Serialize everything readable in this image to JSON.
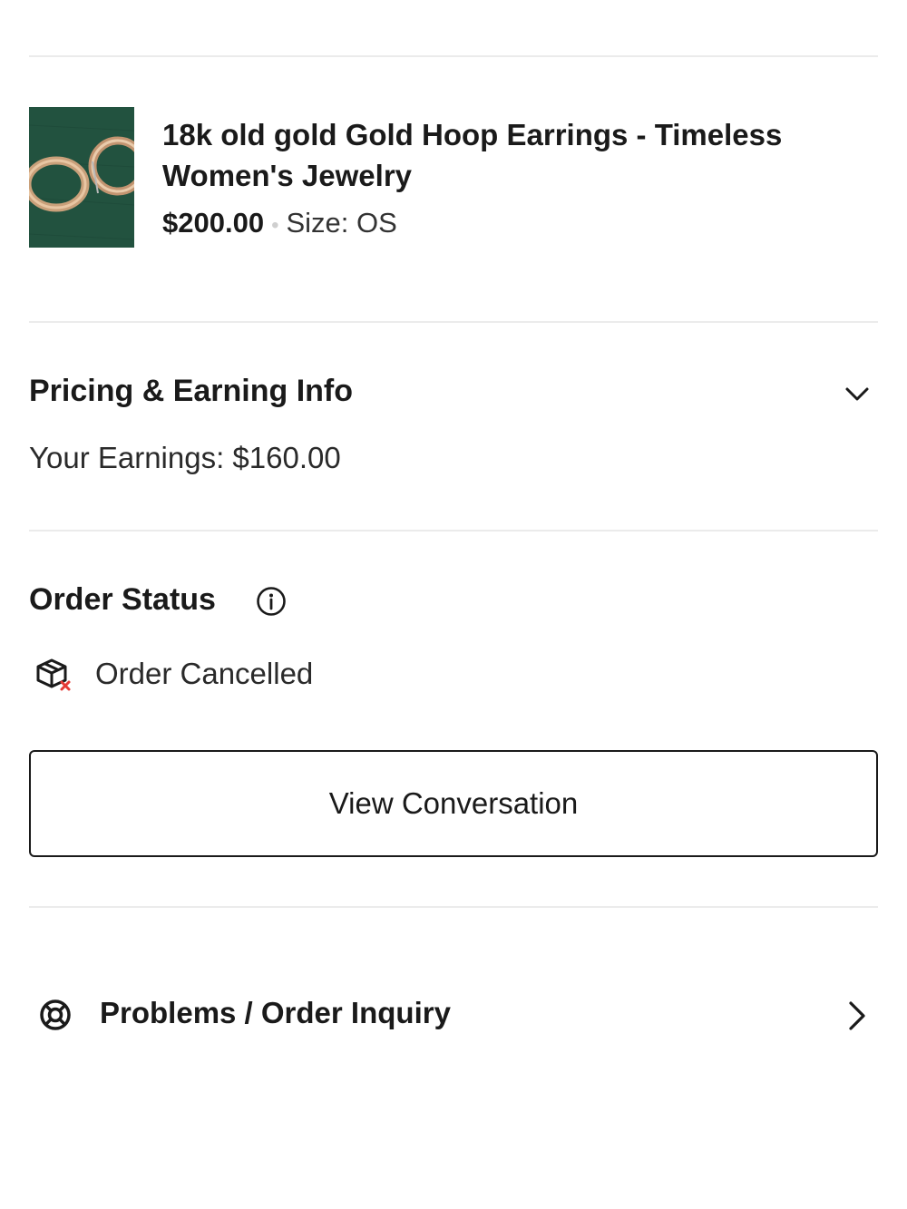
{
  "product": {
    "title": "18k old gold Gold Hoop Earrings - Timeless Women's Jewelry",
    "price": "$200.00",
    "size_label": "Size: ",
    "size_value": "OS",
    "image_icon": "gold-hoop-earrings-photo"
  },
  "pricing": {
    "title": "Pricing & Earning Info",
    "earnings": "Your Earnings: $160.00",
    "toggle_icon": "chevron-down-icon"
  },
  "order_status": {
    "title": "Order Status",
    "info_icon": "info-icon",
    "status_icon": "cancelled-package-icon",
    "status_text": "Order Cancelled",
    "status_icon_accent": "#e53935"
  },
  "actions": {
    "view_conversation": "View Conversation"
  },
  "inquiry": {
    "icon": "lifebuoy-icon",
    "label": "Problems / Order Inquiry",
    "chevron": "chevron-right-icon"
  }
}
